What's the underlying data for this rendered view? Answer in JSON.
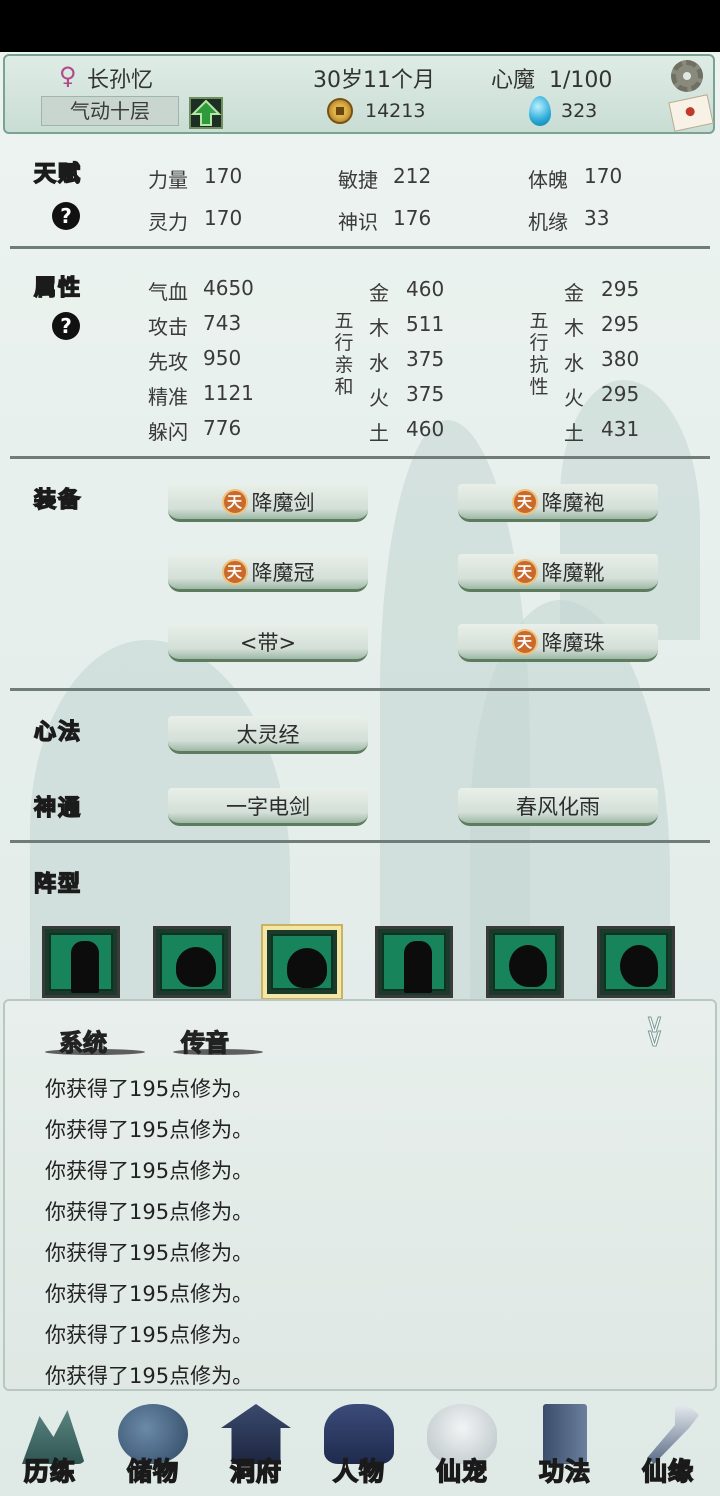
{
  "header": {
    "gender_symbol": "♀",
    "name": "长孙忆",
    "age": "30岁11个月",
    "heart_demon": "心魔  1/100",
    "realm": "气动十层",
    "coins": "14213",
    "spirit_stones": "323"
  },
  "talent": {
    "title": "天赋",
    "help": "?",
    "stats": [
      {
        "label": "力量",
        "value": "170"
      },
      {
        "label": "敏捷",
        "value": "212"
      },
      {
        "label": "体魄",
        "value": "170"
      },
      {
        "label": "灵力",
        "value": "170"
      },
      {
        "label": "神识",
        "value": "176"
      },
      {
        "label": "机缘",
        "value": "33"
      }
    ]
  },
  "attributes": {
    "title": "属性",
    "help": "?",
    "basic": [
      {
        "label": "气血",
        "value": "4650"
      },
      {
        "label": "攻击",
        "value": "743"
      },
      {
        "label": "先攻",
        "value": "950"
      },
      {
        "label": "精准",
        "value": "1121"
      },
      {
        "label": "躲闪",
        "value": "776"
      }
    ],
    "affinity_title": [
      "五",
      "行",
      "亲",
      "和"
    ],
    "affinity": [
      {
        "label": "金",
        "value": "460"
      },
      {
        "label": "木",
        "value": "511"
      },
      {
        "label": "水",
        "value": "375"
      },
      {
        "label": "火",
        "value": "375"
      },
      {
        "label": "土",
        "value": "460"
      }
    ],
    "resist_title": [
      "五",
      "行",
      "抗",
      "性"
    ],
    "resist": [
      {
        "label": "金",
        "value": "295"
      },
      {
        "label": "木",
        "value": "295"
      },
      {
        "label": "水",
        "value": "380"
      },
      {
        "label": "火",
        "value": "295"
      },
      {
        "label": "土",
        "value": "431"
      }
    ]
  },
  "equipment": {
    "title": "装备",
    "badge": "天",
    "items": [
      "降魔剑",
      "降魔袍",
      "降魔冠",
      "降魔靴",
      "<带>",
      "降魔珠"
    ]
  },
  "mind_method": {
    "title": "心法",
    "item": "太灵经"
  },
  "divine_arts": {
    "title": "神通",
    "items": [
      "一字电剑",
      "春风化雨"
    ]
  },
  "formation": {
    "title": "阵型",
    "slots": [
      "human",
      "beast",
      "beast",
      "human",
      "ghost",
      "ghost"
    ],
    "selected_index": 2
  },
  "chat": {
    "tabs": [
      "系统",
      "传音"
    ],
    "messages": [
      "你获得了195点修为。",
      "你获得了195点修为。",
      "你获得了195点修为。",
      "你获得了195点修为。",
      "你获得了195点修为。",
      "你获得了195点修为。",
      "你获得了195点修为。",
      "你获得了195点修为。"
    ]
  },
  "nav": [
    "历练",
    "储物",
    "洞府",
    "人物",
    "仙宠",
    "功法",
    "仙缘"
  ]
}
